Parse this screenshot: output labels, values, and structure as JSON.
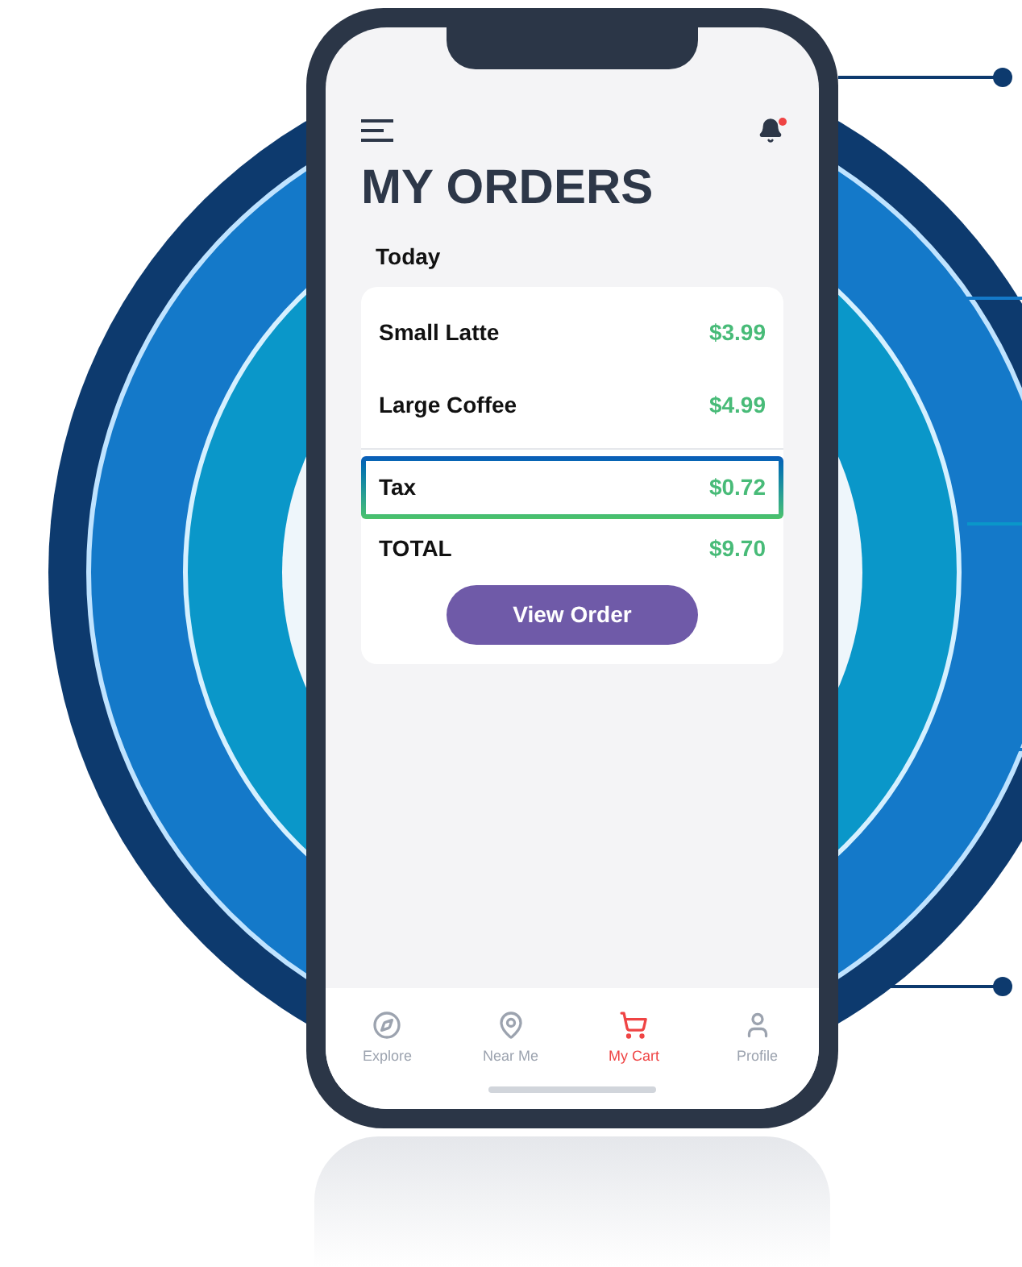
{
  "header": {
    "unread_notifications": true
  },
  "title": "MY ORDERS",
  "section": "Today",
  "items": [
    {
      "name": "Small Latte",
      "price": "$3.99",
      "highlighted": false
    },
    {
      "name": "Large Coffee",
      "price": "$4.99",
      "highlighted": false
    },
    {
      "name": "Tax",
      "price": "$0.72",
      "highlighted": true
    }
  ],
  "total": {
    "label": "TOTAL",
    "price": "$9.70"
  },
  "button": "View Order",
  "tabs": [
    {
      "label": "Explore",
      "kind": "explore",
      "selected": false
    },
    {
      "label": "Near Me",
      "kind": "near",
      "selected": false
    },
    {
      "label": "My Cart",
      "kind": "cart",
      "selected": true
    },
    {
      "label": "Profile",
      "kind": "profile",
      "selected": false
    }
  ]
}
